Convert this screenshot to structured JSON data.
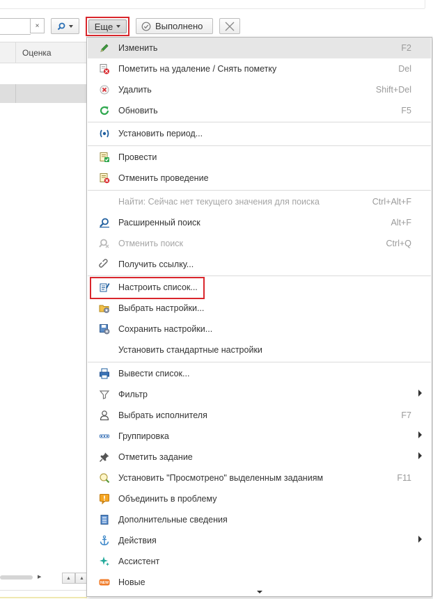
{
  "toolbar": {
    "clear_glyph": "×",
    "more_label": "Еще",
    "done_label": "Выполнено"
  },
  "table": {
    "column_header": "Оценка"
  },
  "menu": {
    "items": [
      {
        "label": "Изменить",
        "shortcut": "F2",
        "icon": "pencil-icon"
      },
      {
        "label": "Пометить на удаление / Снять пометку",
        "shortcut": "Del",
        "icon": "mark-delete-icon"
      },
      {
        "label": "Удалить",
        "shortcut": "Shift+Del",
        "icon": "delete-icon"
      },
      {
        "label": "Обновить",
        "shortcut": "F5",
        "icon": "refresh-icon"
      },
      {
        "label": "Установить период...",
        "shortcut": "",
        "icon": "period-icon"
      },
      {
        "label": "Провести",
        "shortcut": "",
        "icon": "post-icon"
      },
      {
        "label": "Отменить проведение",
        "shortcut": "",
        "icon": "unpost-icon"
      },
      {
        "label": "Найти: Сейчас нет текущего значения для поиска",
        "shortcut": "Ctrl+Alt+F",
        "icon": "",
        "disabled": true
      },
      {
        "label": "Расширенный поиск",
        "shortcut": "Alt+F",
        "icon": "search-icon"
      },
      {
        "label": "Отменить поиск",
        "shortcut": "Ctrl+Q",
        "icon": "cancel-search-icon",
        "disabled": true
      },
      {
        "label": "Получить ссылку...",
        "shortcut": "",
        "icon": "link-icon"
      },
      {
        "label": "Настроить список...",
        "shortcut": "",
        "icon": "configure-list-icon"
      },
      {
        "label": "Выбрать настройки...",
        "shortcut": "",
        "icon": "choose-settings-icon"
      },
      {
        "label": "Сохранить настройки...",
        "shortcut": "",
        "icon": "save-settings-icon"
      },
      {
        "label": "Установить стандартные настройки",
        "shortcut": "",
        "icon": ""
      },
      {
        "label": "Вывести список...",
        "shortcut": "",
        "icon": "print-list-icon"
      },
      {
        "label": "Фильтр",
        "shortcut": "",
        "icon": "filter-icon",
        "submenu": true
      },
      {
        "label": "Выбрать исполнителя",
        "shortcut": "F7",
        "icon": "user-icon"
      },
      {
        "label": "Группировка",
        "shortcut": "",
        "icon": "grouping-icon",
        "submenu": true
      },
      {
        "label": "Отметить задание",
        "shortcut": "",
        "icon": "pin-icon",
        "submenu": true
      },
      {
        "label": "Установить \"Просмотрено\" выделенным заданиям",
        "shortcut": "F11",
        "icon": "viewed-icon"
      },
      {
        "label": "Объединить в проблему",
        "shortcut": "",
        "icon": "merge-problem-icon"
      },
      {
        "label": "Дополнительные сведения",
        "shortcut": "",
        "icon": "details-icon"
      },
      {
        "label": "Действия",
        "shortcut": "",
        "icon": "actions-icon",
        "submenu": true
      },
      {
        "label": "Ассистент",
        "shortcut": "",
        "icon": "assistant-icon"
      },
      {
        "label": "Новые",
        "shortcut": "",
        "icon": "new-icon"
      }
    ]
  },
  "colors": {
    "highlight_border": "#d9262c",
    "active_item_bg": "#e6e6e6",
    "shortcut_text": "#9a9a9a",
    "disabled_text": "#a5a5a5"
  }
}
